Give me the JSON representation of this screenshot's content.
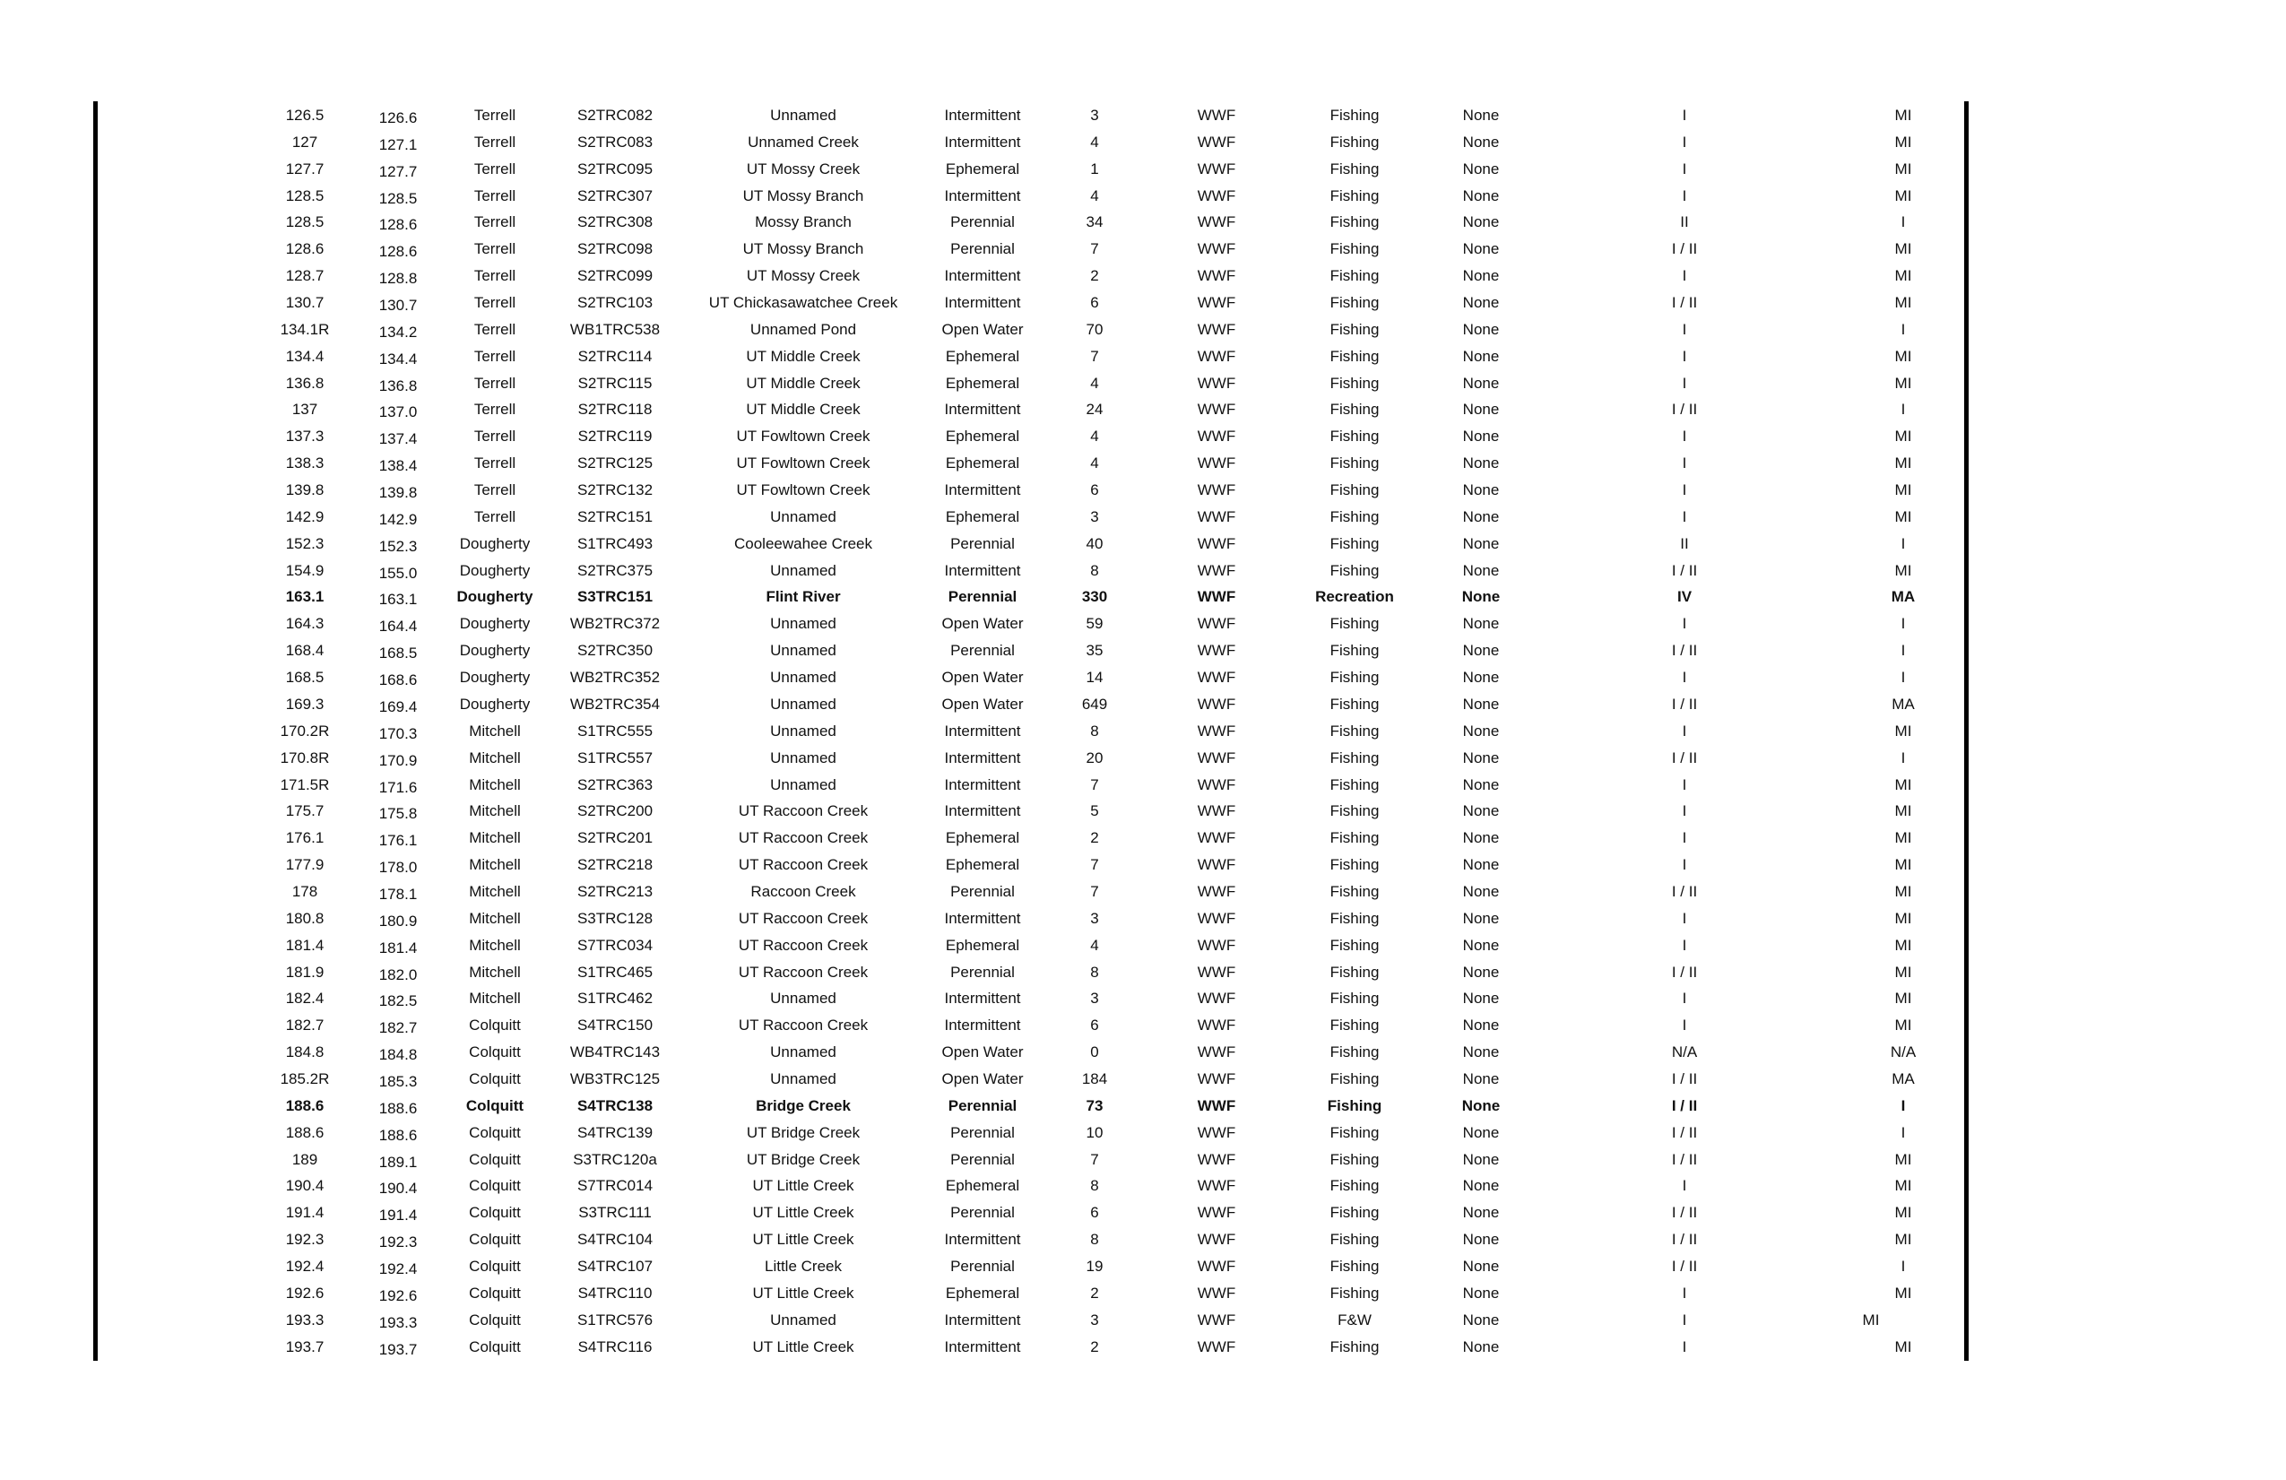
{
  "table": {
    "rows": [
      {
        "c1": "126.5",
        "c2": "126.6",
        "c3": "Terrell",
        "c4": "S2TRC082",
        "c5": "Unnamed",
        "c6": "Intermittent",
        "c7": "3",
        "c8": "WWF",
        "c9": "Fishing",
        "c10": "None",
        "c11": "I",
        "c12": "MI"
      },
      {
        "c1": "127",
        "c2": "127.1",
        "c3": "Terrell",
        "c4": "S2TRC083",
        "c5": "Unnamed Creek",
        "c6": "Intermittent",
        "c7": "4",
        "c8": "WWF",
        "c9": "Fishing",
        "c10": "None",
        "c11": "I",
        "c12": "MI"
      },
      {
        "c1": "127.7",
        "c2": "127.7",
        "c3": "Terrell",
        "c4": "S2TRC095",
        "c5": "UT Mossy Creek",
        "c6": "Ephemeral",
        "c7": "1",
        "c8": "WWF",
        "c9": "Fishing",
        "c10": "None",
        "c11": "I",
        "c12": "MI"
      },
      {
        "c1": "128.5",
        "c2": "128.5",
        "c3": "Terrell",
        "c4": "S2TRC307",
        "c5": "UT Mossy Branch",
        "c6": "Intermittent",
        "c7": "4",
        "c8": "WWF",
        "c9": "Fishing",
        "c10": "None",
        "c11": "I",
        "c12": "MI"
      },
      {
        "c1": "128.5",
        "c2": "128.6",
        "c3": "Terrell",
        "c4": "S2TRC308",
        "c5": "Mossy Branch",
        "c6": "Perennial",
        "c7": "34",
        "c8": "WWF",
        "c9": "Fishing",
        "c10": "None",
        "c11": "II",
        "c12": "I"
      },
      {
        "c1": "128.6",
        "c2": "128.6",
        "c3": "Terrell",
        "c4": "S2TRC098",
        "c5": "UT Mossy Branch",
        "c6": "Perennial",
        "c7": "7",
        "c8": "WWF",
        "c9": "Fishing",
        "c10": "None",
        "c11": "I / II",
        "c12": "MI"
      },
      {
        "c1": "128.7",
        "c2": "128.8",
        "c3": "Terrell",
        "c4": "S2TRC099",
        "c5": "UT Mossy Creek",
        "c6": "Intermittent",
        "c7": "2",
        "c8": "WWF",
        "c9": "Fishing",
        "c10": "None",
        "c11": "I",
        "c12": "MI"
      },
      {
        "c1": "130.7",
        "c2": "130.7",
        "c3": "Terrell",
        "c4": "S2TRC103",
        "c5": "UT Chickasawatchee Creek",
        "c6": "Intermittent",
        "c7": "6",
        "c8": "WWF",
        "c9": "Fishing",
        "c10": "None",
        "c11": "I / II",
        "c12": "MI"
      },
      {
        "c1": "134.1R",
        "c2": "134.2",
        "c3": "Terrell",
        "c4": "WB1TRC538",
        "c5": "Unnamed Pond",
        "c6": "Open Water",
        "c7": "70",
        "c8": "WWF",
        "c9": "Fishing",
        "c10": "None",
        "c11": "I",
        "c12": "I"
      },
      {
        "c1": "134.4",
        "c2": "134.4",
        "c3": "Terrell",
        "c4": "S2TRC114",
        "c5": "UT Middle Creek",
        "c6": "Ephemeral",
        "c7": "7",
        "c8": "WWF",
        "c9": "Fishing",
        "c10": "None",
        "c11": "I",
        "c12": "MI"
      },
      {
        "c1": "136.8",
        "c2": "136.8",
        "c3": "Terrell",
        "c4": "S2TRC115",
        "c5": "UT Middle Creek",
        "c6": "Ephemeral",
        "c7": "4",
        "c8": "WWF",
        "c9": "Fishing",
        "c10": "None",
        "c11": "I",
        "c12": "MI"
      },
      {
        "c1": "137",
        "c2": "137.0",
        "c3": "Terrell",
        "c4": "S2TRC118",
        "c5": "UT Middle Creek",
        "c6": "Intermittent",
        "c7": "24",
        "c8": "WWF",
        "c9": "Fishing",
        "c10": "None",
        "c11": "I / II",
        "c12": "I"
      },
      {
        "c1": "137.3",
        "c2": "137.4",
        "c3": "Terrell",
        "c4": "S2TRC119",
        "c5": "UT Fowltown Creek",
        "c6": "Ephemeral",
        "c7": "4",
        "c8": "WWF",
        "c9": "Fishing",
        "c10": "None",
        "c11": "I",
        "c12": "MI"
      },
      {
        "c1": "138.3",
        "c2": "138.4",
        "c3": "Terrell",
        "c4": "S2TRC125",
        "c5": "UT Fowltown Creek",
        "c6": "Ephemeral",
        "c7": "4",
        "c8": "WWF",
        "c9": "Fishing",
        "c10": "None",
        "c11": "I",
        "c12": "MI"
      },
      {
        "c1": "139.8",
        "c2": "139.8",
        "c3": "Terrell",
        "c4": "S2TRC132",
        "c5": "UT Fowltown Creek",
        "c6": "Intermittent",
        "c7": "6",
        "c8": "WWF",
        "c9": "Fishing",
        "c10": "None",
        "c11": "I",
        "c12": "MI"
      },
      {
        "c1": "142.9",
        "c2": "142.9",
        "c3": "Terrell",
        "c4": "S2TRC151",
        "c5": "Unnamed",
        "c6": "Ephemeral",
        "c7": "3",
        "c8": "WWF",
        "c9": "Fishing",
        "c10": "None",
        "c11": "I",
        "c12": "MI"
      },
      {
        "c1": "152.3",
        "c2": "152.3",
        "c3": "Dougherty",
        "c4": "S1TRC493",
        "c5": "Cooleewahee Creek",
        "c6": "Perennial",
        "c7": "40",
        "c8": "WWF",
        "c9": "Fishing",
        "c10": "None",
        "c11": "II",
        "c12": "I"
      },
      {
        "c1": "154.9",
        "c2": "155.0",
        "c3": "Dougherty",
        "c4": "S2TRC375",
        "c5": "Unnamed",
        "c6": "Intermittent",
        "c7": "8",
        "c8": "WWF",
        "c9": "Fishing",
        "c10": "None",
        "c11": "I / II",
        "c12": "MI"
      },
      {
        "c1": "163.1",
        "c2": "163.1",
        "c3": "Dougherty",
        "c4": "S3TRC151",
        "c5": "Flint River",
        "c6": "Perennial",
        "c7": "330",
        "c8": "WWF",
        "c9": "Recreation",
        "c10": "None",
        "c11": "IV",
        "c12": "MA",
        "bold": true
      },
      {
        "c1": "164.3",
        "c2": "164.4",
        "c3": "Dougherty",
        "c4": "WB2TRC372",
        "c5": "Unnamed",
        "c6": "Open Water",
        "c7": "59",
        "c8": "WWF",
        "c9": "Fishing",
        "c10": "None",
        "c11": "I",
        "c12": "I"
      },
      {
        "c1": "168.4",
        "c2": "168.5",
        "c3": "Dougherty",
        "c4": "S2TRC350",
        "c5": "Unnamed",
        "c6": "Perennial",
        "c7": "35",
        "c8": "WWF",
        "c9": "Fishing",
        "c10": "None",
        "c11": "I / II",
        "c12": "I"
      },
      {
        "c1": "168.5",
        "c2": "168.6",
        "c3": "Dougherty",
        "c4": "WB2TRC352",
        "c5": "Unnamed",
        "c6": "Open Water",
        "c7": "14",
        "c8": "WWF",
        "c9": "Fishing",
        "c10": "None",
        "c11": "I",
        "c12": "I"
      },
      {
        "c1": "169.3",
        "c2": "169.4",
        "c3": "Dougherty",
        "c4": "WB2TRC354",
        "c5": "Unnamed",
        "c6": "Open Water",
        "c7": "649",
        "c8": "WWF",
        "c9": "Fishing",
        "c10": "None",
        "c11": "I / II",
        "c12": "MA"
      },
      {
        "c1": "170.2R",
        "c2": "170.3",
        "c3": "Mitchell",
        "c4": "S1TRC555",
        "c5": "Unnamed",
        "c6": "Intermittent",
        "c7": "8",
        "c8": "WWF",
        "c9": "Fishing",
        "c10": "None",
        "c11": "I",
        "c12": "MI"
      },
      {
        "c1": "170.8R",
        "c2": "170.9",
        "c3": "Mitchell",
        "c4": "S1TRC557",
        "c5": "Unnamed",
        "c6": "Intermittent",
        "c7": "20",
        "c8": "WWF",
        "c9": "Fishing",
        "c10": "None",
        "c11": "I / II",
        "c12": "I"
      },
      {
        "c1": "171.5R",
        "c2": "171.6",
        "c3": "Mitchell",
        "c4": "S2TRC363",
        "c5": "Unnamed",
        "c6": "Intermittent",
        "c7": "7",
        "c8": "WWF",
        "c9": "Fishing",
        "c10": "None",
        "c11": "I",
        "c12": "MI"
      },
      {
        "c1": "175.7",
        "c2": "175.8",
        "c3": "Mitchell",
        "c4": "S2TRC200",
        "c5": "UT Raccoon Creek",
        "c6": "Intermittent",
        "c7": "5",
        "c8": "WWF",
        "c9": "Fishing",
        "c10": "None",
        "c11": "I",
        "c12": "MI"
      },
      {
        "c1": "176.1",
        "c2": "176.1",
        "c3": "Mitchell",
        "c4": "S2TRC201",
        "c5": "UT Raccoon Creek",
        "c6": "Ephemeral",
        "c7": "2",
        "c8": "WWF",
        "c9": "Fishing",
        "c10": "None",
        "c11": "I",
        "c12": "MI"
      },
      {
        "c1": "177.9",
        "c2": "178.0",
        "c3": "Mitchell",
        "c4": "S2TRC218",
        "c5": "UT Raccoon Creek",
        "c6": "Ephemeral",
        "c7": "7",
        "c8": "WWF",
        "c9": "Fishing",
        "c10": "None",
        "c11": "I",
        "c12": "MI"
      },
      {
        "c1": "178",
        "c2": "178.1",
        "c3": "Mitchell",
        "c4": "S2TRC213",
        "c5": "Raccoon Creek",
        "c6": "Perennial",
        "c7": "7",
        "c8": "WWF",
        "c9": "Fishing",
        "c10": "None",
        "c11": "I / II",
        "c12": "MI"
      },
      {
        "c1": "180.8",
        "c2": "180.9",
        "c3": "Mitchell",
        "c4": "S3TRC128",
        "c5": "UT Raccoon Creek",
        "c6": "Intermittent",
        "c7": "3",
        "c8": "WWF",
        "c9": "Fishing",
        "c10": "None",
        "c11": "I",
        "c12": "MI"
      },
      {
        "c1": "181.4",
        "c2": "181.4",
        "c3": "Mitchell",
        "c4": "S7TRC034",
        "c5": "UT Raccoon Creek",
        "c6": "Ephemeral",
        "c7": "4",
        "c8": "WWF",
        "c9": "Fishing",
        "c10": "None",
        "c11": "I",
        "c12": "MI"
      },
      {
        "c1": "181.9",
        "c2": "182.0",
        "c3": "Mitchell",
        "c4": "S1TRC465",
        "c5": "UT Raccoon Creek",
        "c6": "Perennial",
        "c7": "8",
        "c8": "WWF",
        "c9": "Fishing",
        "c10": "None",
        "c11": "I / II",
        "c12": "MI"
      },
      {
        "c1": "182.4",
        "c2": "182.5",
        "c3": "Mitchell",
        "c4": "S1TRC462",
        "c5": "Unnamed",
        "c6": "Intermittent",
        "c7": "3",
        "c8": "WWF",
        "c9": "Fishing",
        "c10": "None",
        "c11": "I",
        "c12": "MI"
      },
      {
        "c1": "182.7",
        "c2": "182.7",
        "c3": "Colquitt",
        "c4": "S4TRC150",
        "c5": "UT Raccoon Creek",
        "c6": "Intermittent",
        "c7": "6",
        "c8": "WWF",
        "c9": "Fishing",
        "c10": "None",
        "c11": "I",
        "c12": "MI"
      },
      {
        "c1": "184.8",
        "c2": "184.8",
        "c3": "Colquitt",
        "c4": "WB4TRC143",
        "c5": "Unnamed",
        "c6": "Open Water",
        "c7": "0",
        "c8": "WWF",
        "c9": "Fishing",
        "c10": "None",
        "c11": "N/A",
        "c12": "N/A"
      },
      {
        "c1": "185.2R",
        "c2": "185.3",
        "c3": "Colquitt",
        "c4": "WB3TRC125",
        "c5": "Unnamed",
        "c6": "Open Water",
        "c7": "184",
        "c8": "WWF",
        "c9": "Fishing",
        "c10": "None",
        "c11": "I / II",
        "c12": "MA"
      },
      {
        "c1": "188.6",
        "c2": "188.6",
        "c3": "Colquitt",
        "c4": "S4TRC138",
        "c5": "Bridge Creek",
        "c6": "Perennial",
        "c7": "73",
        "c8": "WWF",
        "c9": "Fishing",
        "c10": "None",
        "c11": "I / II",
        "c12": "I",
        "bold": true
      },
      {
        "c1": "188.6",
        "c2": "188.6",
        "c3": "Colquitt",
        "c4": "S4TRC139",
        "c5": "UT Bridge Creek",
        "c6": "Perennial",
        "c7": "10",
        "c8": "WWF",
        "c9": "Fishing",
        "c10": "None",
        "c11": "I / II",
        "c12": "I"
      },
      {
        "c1": "189",
        "c2": "189.1",
        "c3": "Colquitt",
        "c4": "S3TRC120a",
        "c5": "UT Bridge Creek",
        "c6": "Perennial",
        "c7": "7",
        "c8": "WWF",
        "c9": "Fishing",
        "c10": "None",
        "c11": "I / II",
        "c12": "MI"
      },
      {
        "c1": "190.4",
        "c2": "190.4",
        "c3": "Colquitt",
        "c4": "S7TRC014",
        "c5": "UT Little Creek",
        "c6": "Ephemeral",
        "c7": "8",
        "c8": "WWF",
        "c9": "Fishing",
        "c10": "None",
        "c11": "I",
        "c12": "MI"
      },
      {
        "c1": "191.4",
        "c2": "191.4",
        "c3": "Colquitt",
        "c4": "S3TRC111",
        "c5": "UT Little Creek",
        "c6": "Perennial",
        "c7": "6",
        "c8": "WWF",
        "c9": "Fishing",
        "c10": "None",
        "c11": "I / II",
        "c12": "MI"
      },
      {
        "c1": "192.3",
        "c2": "192.3",
        "c3": "Colquitt",
        "c4": "S4TRC104",
        "c5": "UT Little Creek",
        "c6": "Intermittent",
        "c7": "8",
        "c8": "WWF",
        "c9": "Fishing",
        "c10": "None",
        "c11": "I / II",
        "c12": "MI"
      },
      {
        "c1": "192.4",
        "c2": "192.4",
        "c3": "Colquitt",
        "c4": "S4TRC107",
        "c5": "Little Creek",
        "c6": "Perennial",
        "c7": "19",
        "c8": "WWF",
        "c9": "Fishing",
        "c10": "None",
        "c11": "I / II",
        "c12": "I"
      },
      {
        "c1": "192.6",
        "c2": "192.6",
        "c3": "Colquitt",
        "c4": "S4TRC110",
        "c5": "UT Little Creek",
        "c6": "Ephemeral",
        "c7": "2",
        "c8": "WWF",
        "c9": "Fishing",
        "c10": "None",
        "c11": "I",
        "c12": "MI"
      },
      {
        "c1": "193.3",
        "c2": "193.3",
        "c3": "Colquitt",
        "c4": "S1TRC576",
        "c5": "Unnamed",
        "c6": "Intermittent",
        "c7": "3",
        "c8": "WWF",
        "c9": "F&W",
        "c10": "None",
        "c11": "I",
        "c12": "MI",
        "c12_offset": true
      },
      {
        "c1": "193.7",
        "c2": "193.7",
        "c3": "Colquitt",
        "c4": "S4TRC116",
        "c5": "UT Little Creek",
        "c6": "Intermittent",
        "c7": "2",
        "c8": "WWF",
        "c9": "Fishing",
        "c10": "None",
        "c11": "I",
        "c12": "MI"
      }
    ]
  }
}
